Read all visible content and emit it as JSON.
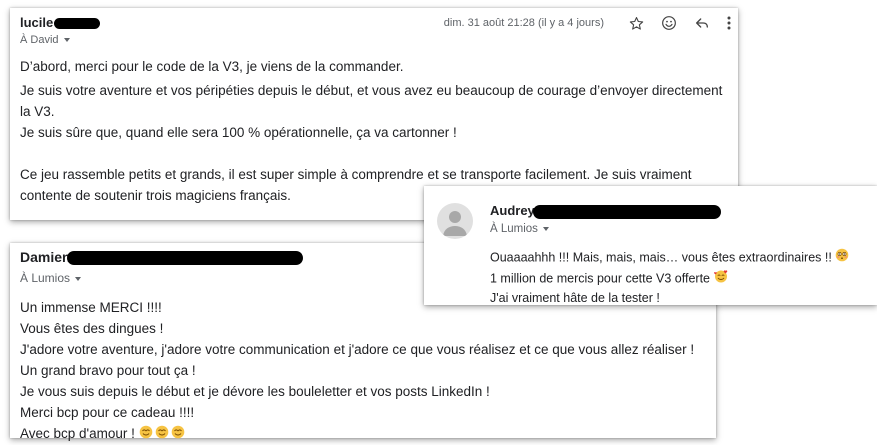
{
  "emails": {
    "lucile": {
      "sender": "lucile",
      "recipient": "À David",
      "date": "dim. 31 août 21:28 (il y a 4 jours)",
      "body": [
        "D’abord, merci pour le code de la V3, je viens de la commander.",
        "Je suis votre aventure et vos péripéties depuis le début, et vous avez eu beaucoup de courage d’envoyer directement la V3.",
        "Je suis sûre que, quand elle sera 100 % opérationnelle, ça va cartonner !",
        "",
        "Ce jeu rassemble petits et grands, il est super simple à comprendre et se transporte facilement. Je suis vraiment contente de soutenir trois magiciens français."
      ],
      "icons": [
        "star-icon",
        "emoji-icon",
        "reply-icon",
        "more-icon"
      ]
    },
    "damien": {
      "sender": "Damien",
      "recipient": "À Lumios",
      "body": [
        "Un immense MERCI !!!!",
        "Vous êtes des dingues !",
        "J'adore votre aventure, j'adore votre communication et j'adore ce que vous réalisez et ce que vous allez réaliser !",
        "Un grand bravo pour tout ça !",
        "Je vous suis depuis le début et je dévore les bouleletter et vos posts LinkedIn !",
        "Merci bcp pour ce cadeau !!!!",
        "Avec bcp d'amour !"
      ]
    },
    "audrey": {
      "sender": "Audrey",
      "recipient": "À Lumios",
      "body": [
        "Ouaaaahhh !!! Mais, mais, mais… vous êtes extraordinaires !!",
        "1 million de mercis pour cette V3 offerte",
        "J'ai vraiment hâte de la tester !"
      ]
    }
  },
  "colors": {
    "text": "#202124",
    "secondary": "#5f6368",
    "redaction": "#000000",
    "emoji": "#f6c343"
  }
}
